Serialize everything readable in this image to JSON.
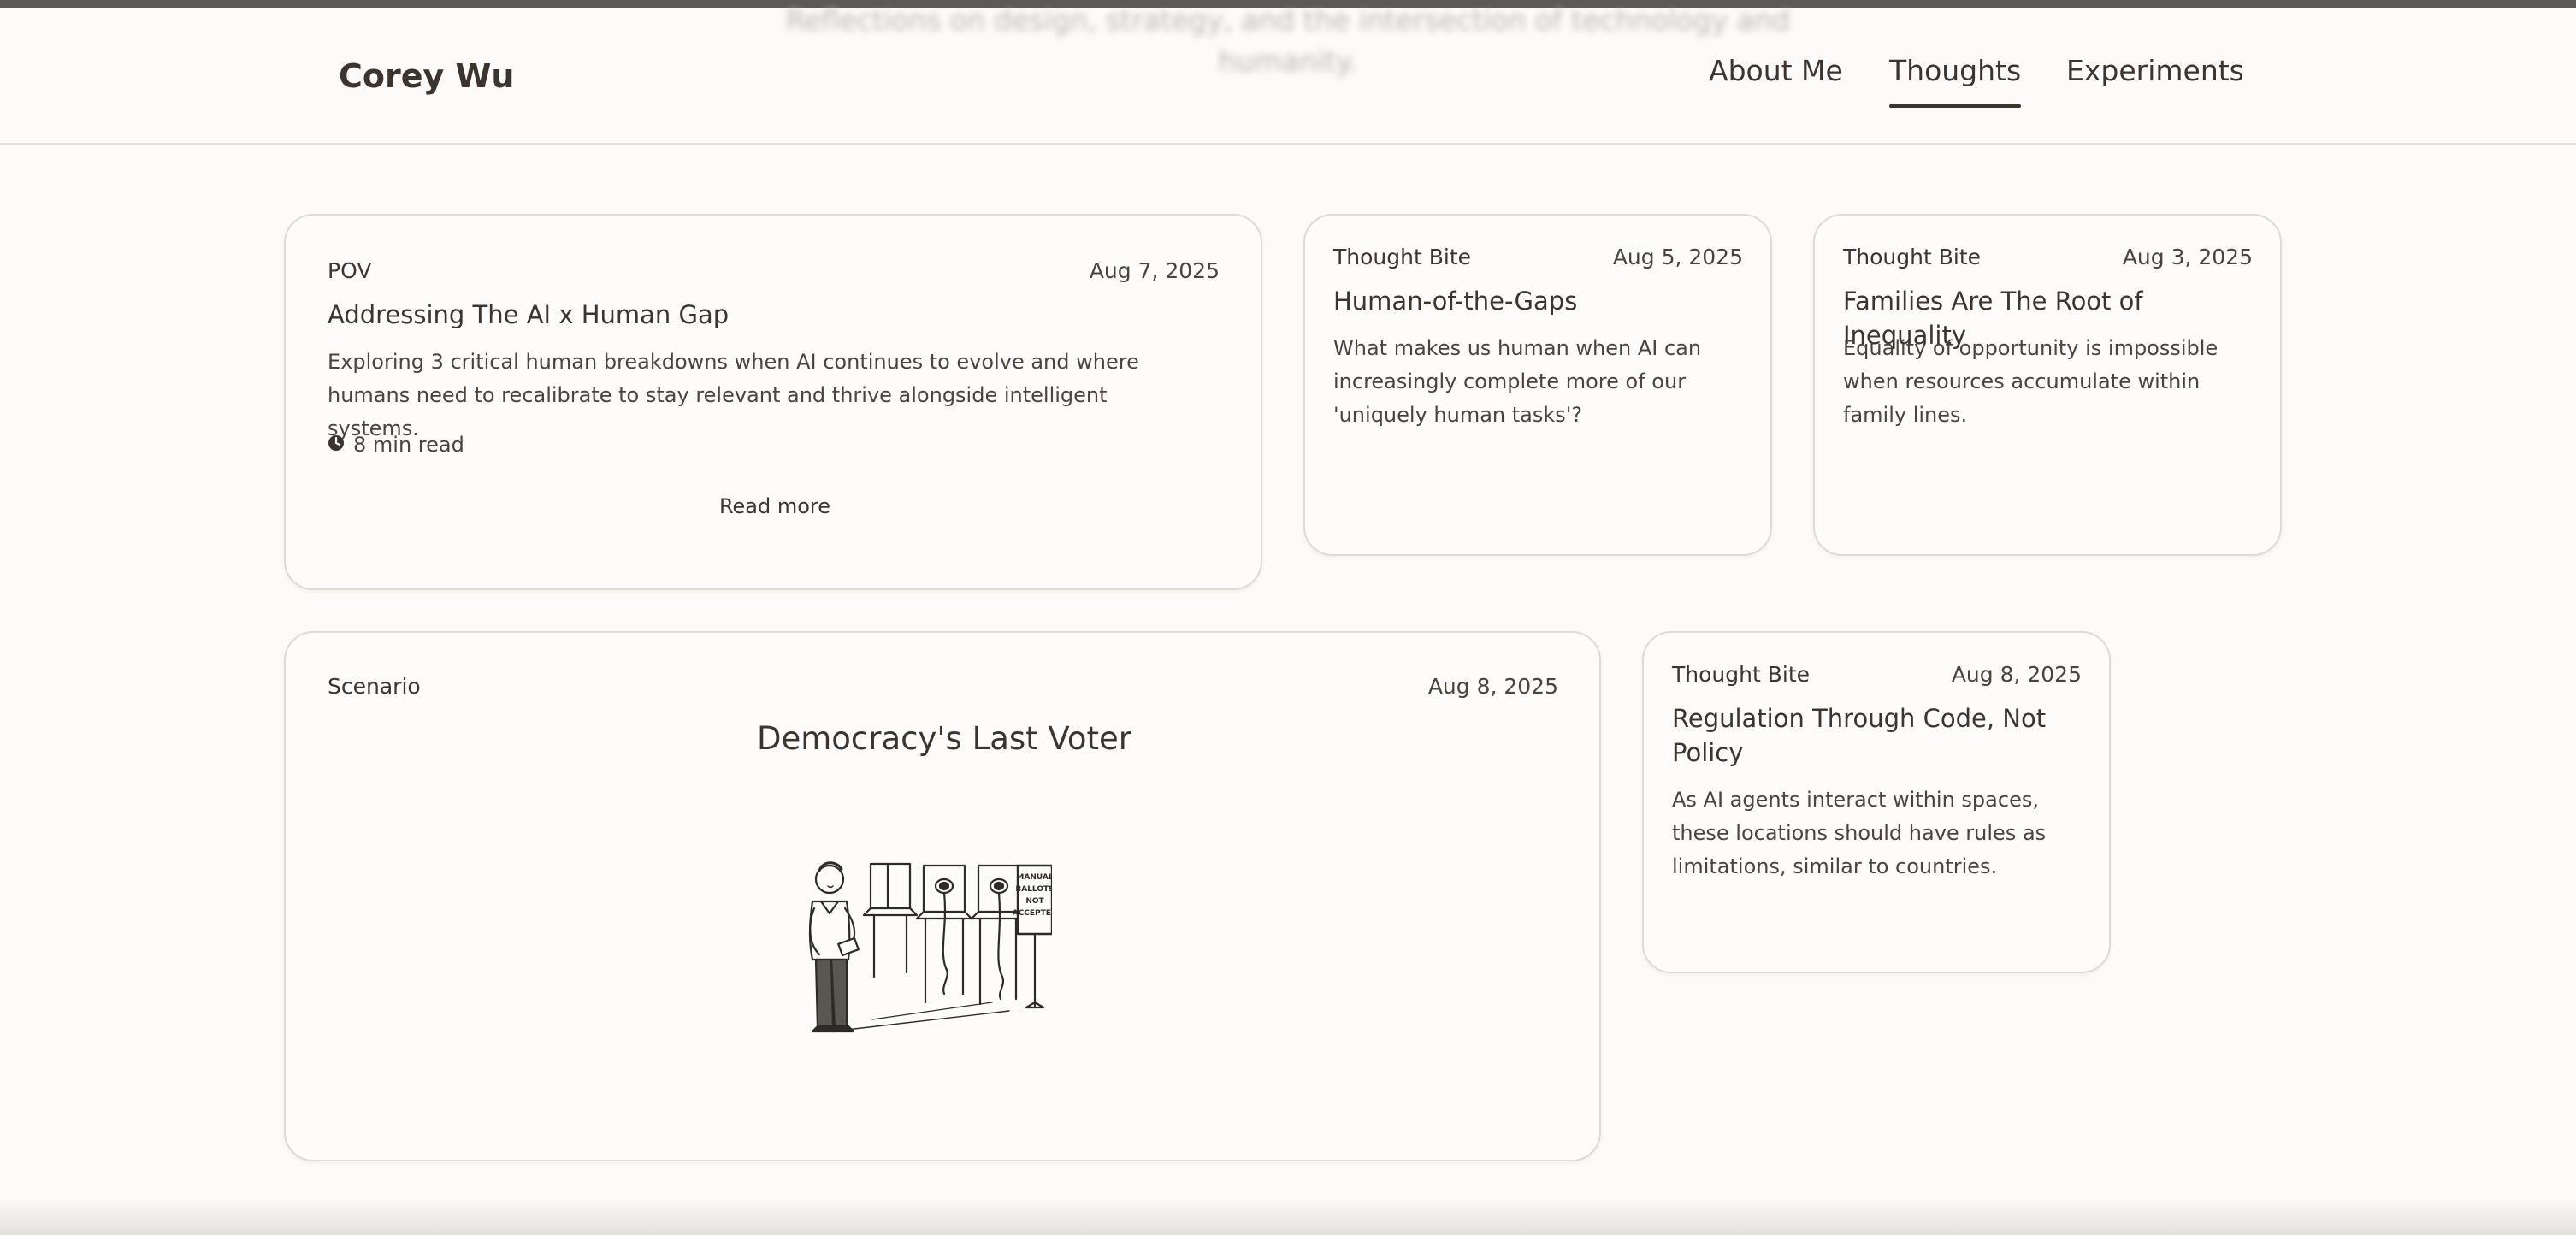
{
  "ghost_text": {
    "line1": "Reflections on design, strategy, and the intersection of technology and",
    "line2": "humanity."
  },
  "header": {
    "brand": "Corey Wu",
    "nav": [
      {
        "label": "About Me",
        "active": false
      },
      {
        "label": "Thoughts",
        "active": true
      },
      {
        "label": "Experiments",
        "active": false
      }
    ]
  },
  "cards": {
    "pov": {
      "tag": "POV",
      "date": "Aug 7, 2025",
      "title": "Addressing The AI x Human Gap",
      "desc": "Exploring 3 critical human breakdowns when AI continues to evolve and where humans need to recalibrate to stay relevant and thrive alongside intelligent systems.",
      "read_time": "8 min read",
      "read_more": "Read more",
      "icon": "clock-icon"
    },
    "gaps": {
      "tag": "Thought Bite",
      "date": "Aug 5, 2025",
      "title": "Human-of-the-Gaps",
      "desc": "What makes us human when AI can increasingly complete more of our 'uniquely human tasks'?"
    },
    "families": {
      "tag": "Thought Bite",
      "date": "Aug 3, 2025",
      "title": "Families Are The Root of Inequality",
      "desc": "Equality of opportunity is impossible when resources accumulate within family lines."
    },
    "scenario": {
      "tag": "Scenario",
      "date": "Aug 8, 2025",
      "title": "Democracy's Last Voter",
      "sign_text": [
        "MANUAL",
        "BALLOTS",
        "NOT",
        "ACCEPTED"
      ]
    },
    "regulation": {
      "tag": "Thought Bite",
      "date": "Aug 8, 2025",
      "title": "Regulation Through Code, Not Policy",
      "desc": "As AI agents interact within spaces, these locations should have rules as limitations, similar to countries."
    }
  },
  "colors": {
    "background": "#fcfbf9",
    "text": "#3b342f",
    "card_border": "#dedad6",
    "topbar": "#5a5a59"
  }
}
